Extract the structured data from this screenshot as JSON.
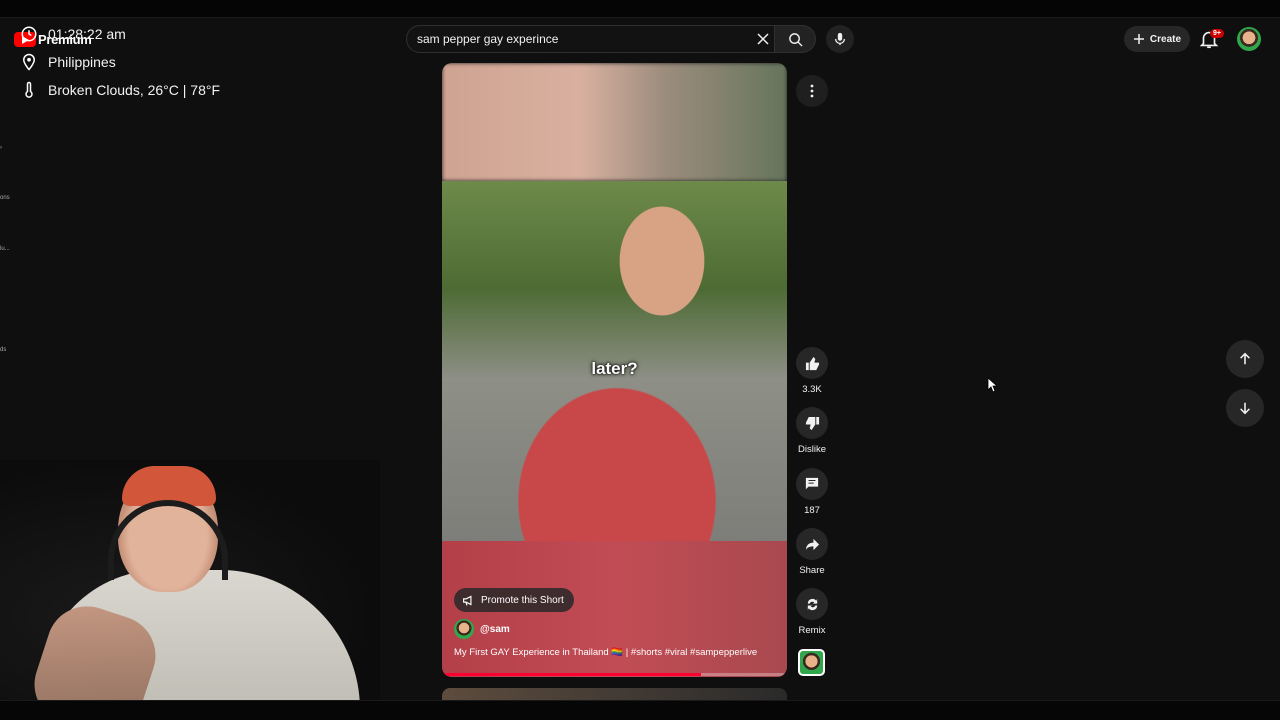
{
  "overlay": {
    "time": "01:28:22 am",
    "location": "Philippines",
    "weather": "Broken Clouds, 26°C | 78°F"
  },
  "brand": {
    "premium_label": "Premium"
  },
  "sidebar_stubs": [
    "ons",
    "lu...",
    "ds"
  ],
  "search": {
    "value": "sam pepper gay experince"
  },
  "header": {
    "create_label": "Create",
    "notif_badge": "9+"
  },
  "short": {
    "caption": "later?",
    "promote_label": "Promote this Short",
    "channel": "@sam",
    "title": "My First GAY Experience in Thailand 🏳️‍🌈 | #shorts #viral #sampepperlive",
    "progress_percent": 75
  },
  "actions": {
    "likes": "3.3K",
    "dislike_label": "Dislike",
    "comments": "187",
    "share_label": "Share",
    "remix_label": "Remix"
  },
  "colors": {
    "accent": "#ff0033",
    "brand_red": "#ff0000",
    "badge": "#cc0000"
  },
  "icons": [
    "clock-icon",
    "location-pin-icon",
    "thermometer-icon",
    "close-icon",
    "search-icon",
    "mic-icon",
    "plus-icon",
    "bell-icon",
    "more-vert-icon",
    "thumb-up-icon",
    "thumb-down-icon",
    "comment-icon",
    "share-icon",
    "remix-icon",
    "arrow-up-icon",
    "arrow-down-icon",
    "megaphone-icon"
  ]
}
